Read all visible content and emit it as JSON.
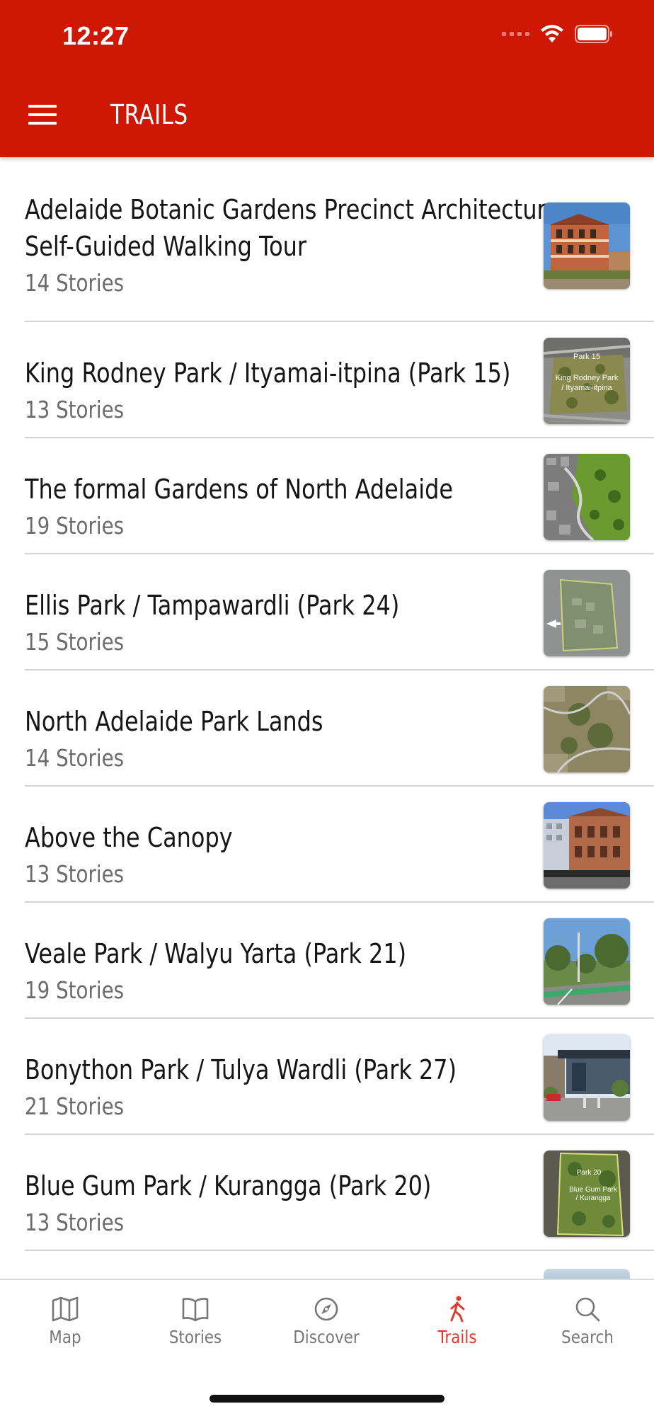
{
  "status_bar": {
    "time": "12:27"
  },
  "header": {
    "title": "TRAILS"
  },
  "trails": [
    {
      "name_line1": "Adelaide Botanic Gardens Precinct Architecture",
      "name_line2": "Self-Guided Walking Tour",
      "count": "14 Stories"
    },
    {
      "name": "King Rodney Park / Ityamai-itpina (Park 15)",
      "count": "13 Stories",
      "thumb_label1": "Park 15",
      "thumb_label2": "King Rodney Park",
      "thumb_label3": "/ Ityamai-itpina"
    },
    {
      "name": "The formal Gardens of North Adelaide",
      "count": "19 Stories"
    },
    {
      "name": "Ellis Park / Tampawardli (Park 24)",
      "count": "15 Stories"
    },
    {
      "name": "North Adelaide Park Lands",
      "count": "14 Stories"
    },
    {
      "name": "Above the Canopy",
      "count": "13 Stories"
    },
    {
      "name": "Veale Park / Walyu Yarta (Park 21)",
      "count": "19 Stories"
    },
    {
      "name": "Bonython Park / Tulya Wardli (Park 27)",
      "count": "21 Stories"
    },
    {
      "name": "Blue Gum Park / Kurangga (Park 20)",
      "count": "13 Stories",
      "thumb_label1": "Park 20",
      "thumb_label2": "Blue Gum Park",
      "thumb_label3": "/ Kurangga"
    }
  ],
  "tabs": [
    {
      "label": "Map",
      "icon": "map-icon"
    },
    {
      "label": "Stories",
      "icon": "book-icon"
    },
    {
      "label": "Discover",
      "icon": "compass-icon"
    },
    {
      "label": "Trails",
      "icon": "walking-person-icon",
      "active": true
    },
    {
      "label": "Search",
      "icon": "search-icon"
    }
  ],
  "colors": {
    "header": "#cf1705",
    "active_tab": "#e03a2a",
    "inactive_tab": "#777777"
  }
}
